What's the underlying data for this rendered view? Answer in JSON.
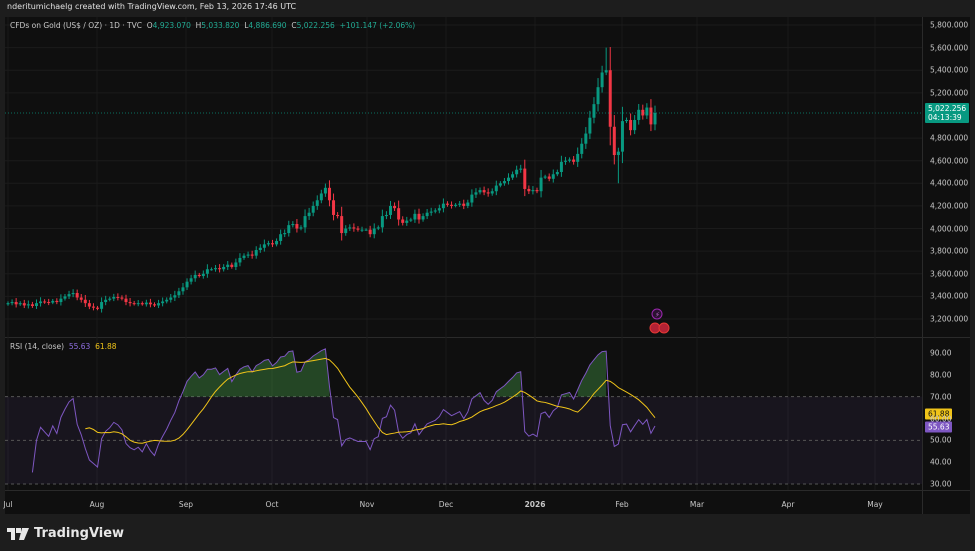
{
  "credit": "nderitumichaelg created with TradingView.com, Feb 13, 2026 17:46 UTC",
  "legend": {
    "symbol": "CFDs on Gold (US$ / OZ) · 1D · TVC",
    "o_label": "O",
    "o": "4,923.070",
    "h_label": "H",
    "h": "5,033.820",
    "l_label": "L",
    "l": "4,886.690",
    "c_label": "C",
    "c": "5,022.256",
    "change": "+101.147 (+2.06%)"
  },
  "price_tag": {
    "price": "5,022.256",
    "countdown": "04:13:39"
  },
  "rsi": {
    "label": "RSI (14, close)",
    "value": "55.63",
    "ma_value": "61.88"
  },
  "brand": "TradingView",
  "colors": {
    "up": "#089981",
    "down": "#f23645",
    "rsi": "#7e57c2",
    "rsi_ma": "#f0c419",
    "bg": "#0f0f0f"
  },
  "chart_data": {
    "type": "candlestick",
    "title": "CFDs on Gold (US$ / OZ) · 1D · TVC",
    "price_ticks": [
      "5,800.000",
      "5,600.000",
      "5,400.000",
      "5,200.000",
      "4,800.000",
      "4,600.000",
      "4,400.000",
      "4,200.000",
      "4,000.000",
      "3,800.000",
      "3,600.000",
      "3,400.000",
      "3,200.000"
    ],
    "price_tick_values": [
      5800,
      5600,
      5400,
      5200,
      4800,
      4600,
      4400,
      4200,
      4000,
      3800,
      3600,
      3400,
      3200
    ],
    "rsi_ticks": [
      "90.00",
      "80.00",
      "70.00",
      "60.00",
      "50.00",
      "40.00",
      "30.00"
    ],
    "rsi_tick_values": [
      90,
      80,
      70,
      60,
      50,
      40,
      30
    ],
    "x_ticks": [
      "Jul",
      "Aug",
      "Sep",
      "Oct",
      "Nov",
      "Dec",
      "2026",
      "Feb",
      "Mar",
      "Apr",
      "May"
    ],
    "ylim": [
      3200,
      5800
    ],
    "last_close": 5022.256,
    "closes": [
      3340,
      3350,
      3330,
      3340,
      3320,
      3330,
      3315,
      3340,
      3355,
      3350,
      3345,
      3360,
      3350,
      3380,
      3400,
      3420,
      3430,
      3390,
      3370,
      3340,
      3310,
      3300,
      3290,
      3350,
      3370,
      3380,
      3395,
      3390,
      3380,
      3350,
      3340,
      3335,
      3340,
      3330,
      3345,
      3330,
      3320,
      3340,
      3355,
      3370,
      3390,
      3410,
      3445,
      3480,
      3530,
      3560,
      3590,
      3580,
      3600,
      3640,
      3640,
      3650,
      3640,
      3660,
      3680,
      3660,
      3700,
      3740,
      3760,
      3770,
      3760,
      3810,
      3830,
      3860,
      3870,
      3860,
      3890,
      3950,
      3960,
      4030,
      4040,
      4000,
      4010,
      4110,
      4140,
      4200,
      4250,
      4310,
      4360,
      4250,
      4120,
      4110,
      3960,
      4000,
      4010,
      4000,
      3990,
      3990,
      3990,
      3950,
      4000,
      4010,
      4110,
      4120,
      4200,
      4180,
      4080,
      4050,
      4070,
      4080,
      4130,
      4080,
      4110,
      4140,
      4150,
      4160,
      4180,
      4220,
      4210,
      4200,
      4210,
      4220,
      4200,
      4230,
      4300,
      4320,
      4340,
      4320,
      4310,
      4330,
      4380,
      4400,
      4420,
      4450,
      4480,
      4520,
      4530,
      4350,
      4330,
      4340,
      4330,
      4450,
      4460,
      4440,
      4480,
      4500,
      4590,
      4600,
      4610,
      4590,
      4660,
      4750,
      4840,
      4980,
      5100,
      5250,
      5380,
      5400,
      4900,
      4650,
      4680,
      4950,
      4960,
      4870,
      4960,
      5050,
      5000,
      5070,
      4921,
      5022
    ]
  }
}
